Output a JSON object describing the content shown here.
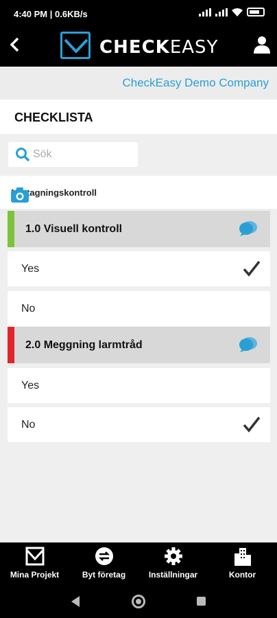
{
  "status_bar": {
    "time": "4:40 PM | 0.6KB/s",
    "battery_level": 0.6
  },
  "header": {
    "brand_bold": "CHECK",
    "brand_light": "EASY"
  },
  "company": "CheckEasy Demo Company",
  "page_title": "CHECKLISTA",
  "search": {
    "placeholder": "Sök"
  },
  "section": {
    "title": "Mottagningskontroll"
  },
  "groups": [
    {
      "label": "1.0 Visuell kontroll",
      "status_color": "#7cc23a",
      "options": [
        {
          "label": "Yes",
          "checked": true
        },
        {
          "label": "No",
          "checked": false
        }
      ]
    },
    {
      "label": "2.0 Meggning larmtråd",
      "status_color": "#e2252b",
      "options": [
        {
          "label": "Yes",
          "checked": false
        },
        {
          "label": "No",
          "checked": true
        }
      ]
    }
  ],
  "bottom_nav": [
    {
      "label": "Mina Projekt",
      "icon": "inbox-icon"
    },
    {
      "label": "Byt företag",
      "icon": "swap-icon"
    },
    {
      "label": "Inställningar",
      "icon": "gear-icon"
    },
    {
      "label": "Kontor",
      "icon": "building-icon"
    }
  ],
  "colors": {
    "accent": "#2a9fd6",
    "header_bg": "#000000",
    "group_bg": "#d8d8d8"
  }
}
